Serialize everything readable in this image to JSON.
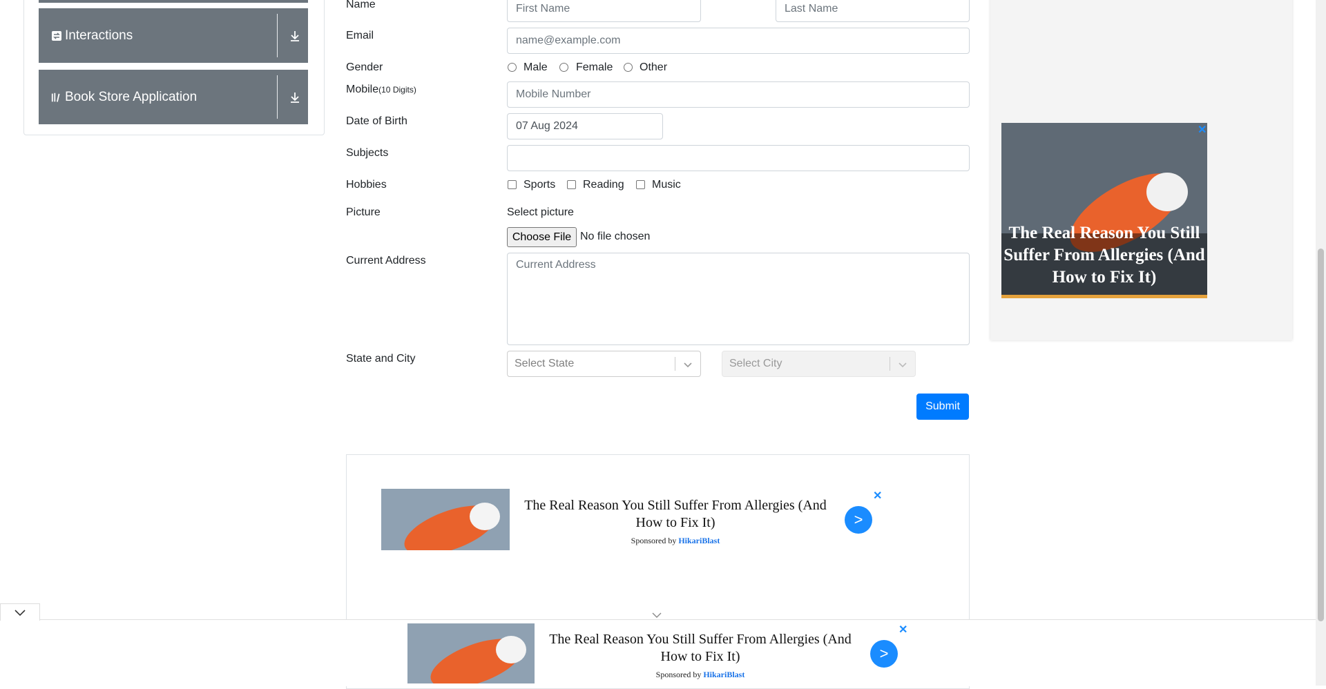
{
  "sidebar": {
    "groups": [
      {
        "label": "Interactions",
        "icon": "interactions-icon"
      },
      {
        "label": "Book Store Application",
        "icon": "book-icon"
      }
    ]
  },
  "form": {
    "name_label": "Name",
    "first_name_placeholder": "First Name",
    "last_name_placeholder": "Last Name",
    "email_label": "Email",
    "email_placeholder": "name@example.com",
    "gender_label": "Gender",
    "genders": [
      "Male",
      "Female",
      "Other"
    ],
    "mobile_label": "Mobile",
    "mobile_hint": "(10 Digits)",
    "mobile_placeholder": "Mobile Number",
    "dob_label": "Date of Birth",
    "dob_value": "07 Aug 2024",
    "subjects_label": "Subjects",
    "hobbies_label": "Hobbies",
    "hobbies": [
      "Sports",
      "Reading",
      "Music"
    ],
    "picture_label": "Picture",
    "select_picture": "Select picture",
    "choose_file": "Choose File",
    "no_file": "No file chosen",
    "address_label": "Current Address",
    "address_placeholder": "Current Address",
    "state_city_label": "State and City",
    "state_placeholder": "Select State",
    "city_placeholder": "Select City",
    "submit_label": "Submit"
  },
  "ads": {
    "side_title": "The Real Reason You Still Suffer From Allergies (And How to Fix It)",
    "inline_title": "The Real Reason You Still Suffer From Allergies (And How to Fix It)",
    "sponsor_prefix": "Sponsored by",
    "sponsor_name": "HikariBlast",
    "go_label": ">",
    "close_label": "✕"
  },
  "colors": {
    "accent": "#007bff",
    "sidebar_header": "#6c757d",
    "ad_button": "#1a8cff"
  }
}
